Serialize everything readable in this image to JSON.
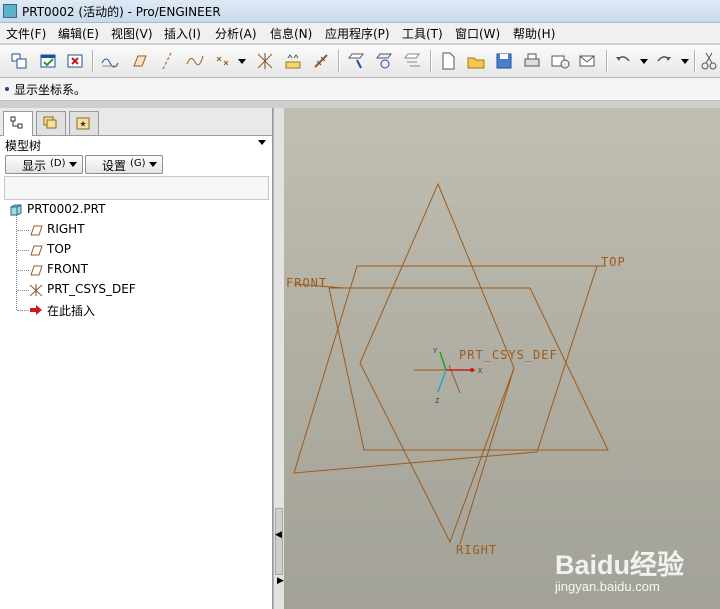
{
  "window": {
    "title": "PRT0002 (活动的) - Pro/ENGINEER"
  },
  "menu": [
    "文件(F)",
    "编辑(E)",
    "视图(V)",
    "插入(I)",
    "分析(A)",
    "信息(N)",
    "应用程序(P)",
    "工具(T)",
    "窗口(W)",
    "帮助(H)"
  ],
  "message": "显示坐标系。",
  "panel": {
    "tree_header": "模型树",
    "show_button": {
      "label": "显示",
      "hotkey": "(D)"
    },
    "settings_button": {
      "label": "设置",
      "hotkey": "(G)"
    },
    "filter_value": "",
    "items": [
      {
        "label": "PRT0002.PRT",
        "icon": "part-icon"
      },
      {
        "label": "RIGHT",
        "icon": "datum-plane-icon"
      },
      {
        "label": "TOP",
        "icon": "datum-plane-icon"
      },
      {
        "label": "FRONT",
        "icon": "datum-plane-icon"
      },
      {
        "label": "PRT_CSYS_DEF",
        "icon": "coordinate-system-icon"
      },
      {
        "label": "在此插入",
        "icon": "insert-here-arrow-icon"
      }
    ]
  },
  "viewport": {
    "labels": {
      "front": "FRONT",
      "top": "TOP",
      "right": "RIGHT",
      "csys": "PRT_CSYS_DEF"
    },
    "axis_labels": {
      "x": "X",
      "y": "Y",
      "z": "Z"
    },
    "datum_color": "#9c5a1a",
    "background_color": "#b4b2a6"
  },
  "watermark": {
    "logo": "Baidu经验",
    "url": "jingyan.baidu.com"
  }
}
